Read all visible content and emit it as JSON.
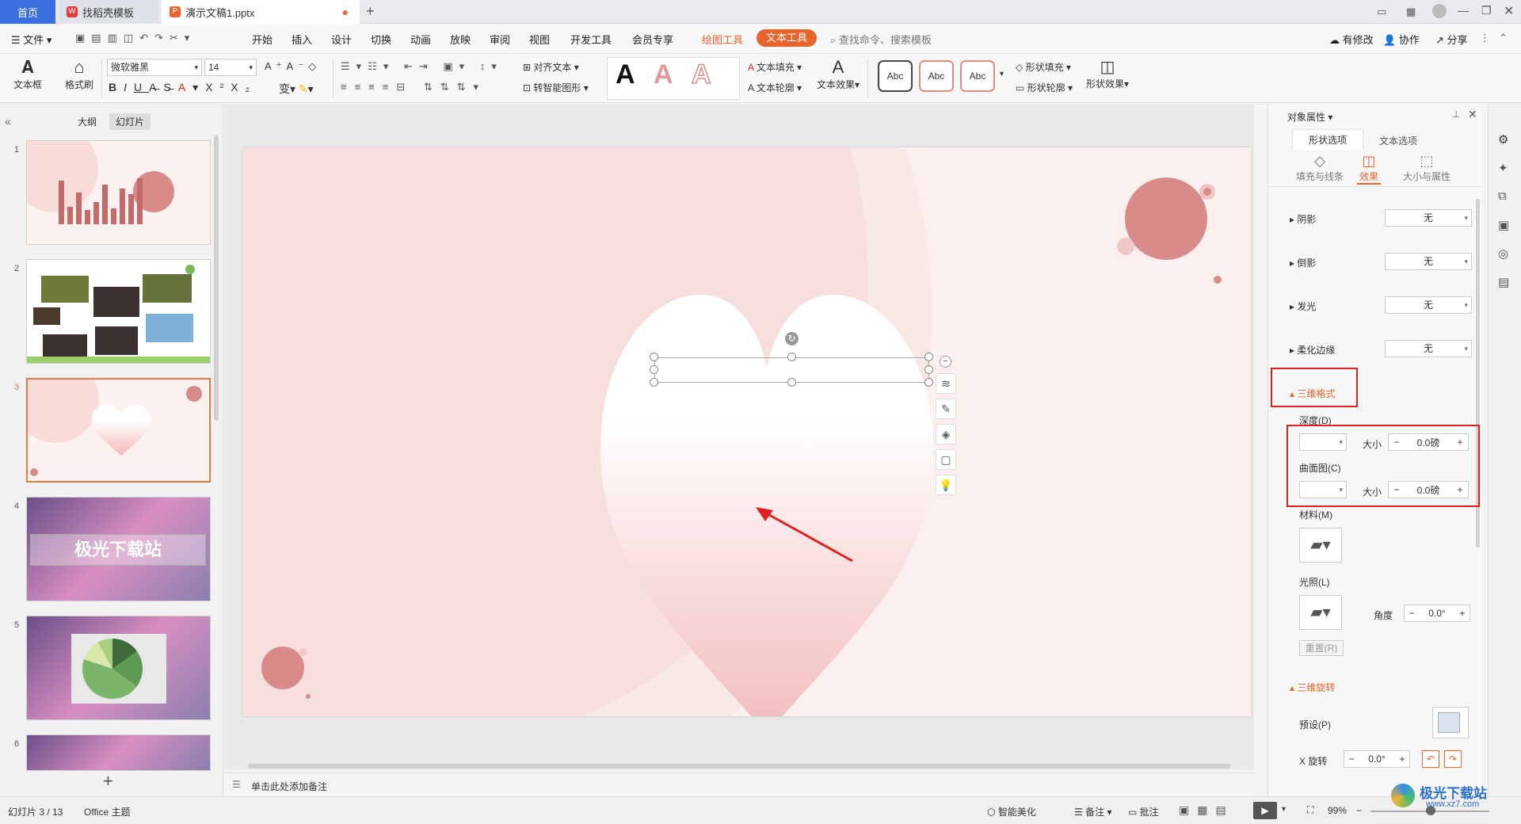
{
  "tabs": {
    "home": "首页",
    "template": "找稻壳模板",
    "document": "演示文稿1.pptx"
  },
  "menu": {
    "file": "文件",
    "items": [
      "开始",
      "插入",
      "设计",
      "切换",
      "动画",
      "放映",
      "审阅",
      "视图",
      "开发工具",
      "会员专享"
    ],
    "draw_tools": "绘图工具",
    "text_tools": "文本工具",
    "search_placeholder": "查找命令、搜索模板",
    "right": [
      "有修改",
      "协作",
      "分享"
    ]
  },
  "ribbon": {
    "textbox": "文本框",
    "format_brush": "格式刷",
    "font_name": "微软雅黑",
    "font_size": "14",
    "align_text": "对齐文本",
    "smart_shape": "转智能图形",
    "text_fill": "文本填充",
    "text_outline": "文本轮廓",
    "text_effect": "文本效果",
    "abc": "Abc",
    "shape_fill": "形状填充",
    "shape_outline": "形状轮廓",
    "shape_effect": "形状效果"
  },
  "left_panel": {
    "outline": "大纲",
    "slides": "幻灯片",
    "slide_numbers": [
      "1",
      "2",
      "3",
      "4",
      "5",
      "6"
    ],
    "slide4_text": "极光下载站"
  },
  "notes_placeholder": "单击此处添加备注",
  "right_panel": {
    "title": "对象属性",
    "tab_shape": "形状选项",
    "tab_text": "文本选项",
    "sub_fill": "填充与线条",
    "sub_effect": "效果",
    "sub_size": "大小与属性",
    "shadow": "阴影",
    "reflection": "倒影",
    "glow": "发光",
    "soft_edge": "柔化边缘",
    "none": "无",
    "format_3d": "三维格式",
    "depth": "深度(D)",
    "contour": "曲面图(C)",
    "size": "大小",
    "size_value": "0.0磅",
    "material": "材料(M)",
    "lighting": "光照(L)",
    "angle": "角度",
    "angle_value": "0.0°",
    "reset": "重置(R)",
    "rotation_3d": "三维旋转",
    "preset": "预设(P)",
    "x_rotation": "X 旋转",
    "x_value": "0.0°"
  },
  "status": {
    "slide_info": "幻灯片 3 / 13",
    "theme": "Office 主题",
    "beautify": "智能美化",
    "notes": "备注",
    "comments": "批注",
    "zoom": "99%"
  },
  "watermark": {
    "name": "极光下载站",
    "url": "www.xz7.com"
  },
  "colors": {
    "accent_blue": "#3b6fe0",
    "accent_orange": "#e8642c",
    "highlight_red": "#e02020",
    "circle_pink": "#d98b89"
  }
}
